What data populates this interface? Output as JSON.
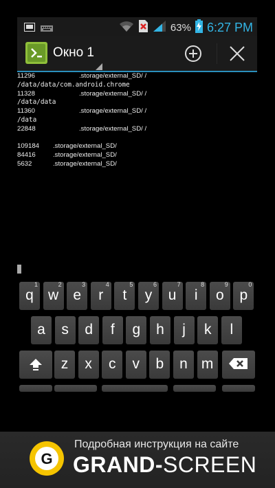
{
  "status_bar": {
    "battery_percent": "63%",
    "time": "6:27 PM",
    "icons": [
      "screen-icon",
      "keyboard-icon",
      "wifi-icon",
      "sim-icon",
      "signal-icon",
      "battery-charging-icon"
    ]
  },
  "action_bar": {
    "title": "Окно 1",
    "icons": [
      "app-icon",
      "add-window-icon",
      "close-window-icon"
    ]
  },
  "terminal": {
    "lines": [
      {
        "size": "11296",
        "path": ".storage/external_SD/ /",
        "style": "far"
      },
      {
        "text": "/data/data/com.android.chrome",
        "style": "mono"
      },
      {
        "size": "11328",
        "path": ".storage/external_SD/ /",
        "style": "far"
      },
      {
        "text": "/data/data",
        "style": "mono"
      },
      {
        "size": "11360",
        "path": ".storage/external_SD/ /",
        "style": "far"
      },
      {
        "text": "/data",
        "style": "mono"
      },
      {
        "size": "22848",
        "path": ".storage/external_SD/ /",
        "style": "far"
      },
      {
        "text": "",
        "style": "blank"
      },
      {
        "size": "109184",
        "path": ".storage/external_SD/",
        "style": "near"
      },
      {
        "size": "84416",
        "path": ".storage/external_SD/",
        "style": "near"
      },
      {
        "size": "5632",
        "path": ".storage/external_SD/",
        "style": "near"
      }
    ]
  },
  "keyboard": {
    "row1": [
      {
        "k": "q",
        "h": "1"
      },
      {
        "k": "w",
        "h": "2"
      },
      {
        "k": "e",
        "h": "3"
      },
      {
        "k": "r",
        "h": "4"
      },
      {
        "k": "t",
        "h": "5"
      },
      {
        "k": "y",
        "h": "6"
      },
      {
        "k": "u",
        "h": "7"
      },
      {
        "k": "i",
        "h": "8"
      },
      {
        "k": "o",
        "h": "9"
      },
      {
        "k": "p",
        "h": "0"
      }
    ],
    "row2": [
      "a",
      "s",
      "d",
      "f",
      "g",
      "h",
      "j",
      "k",
      "l"
    ],
    "row3": [
      "z",
      "x",
      "c",
      "v",
      "b",
      "n",
      "m"
    ]
  },
  "banner": {
    "line1": "Подробная инструкция на сайте",
    "brand_bold": "GRAND-",
    "brand_regular": "SCREEN",
    "logo_letter": "G"
  },
  "colors": {
    "accent": "#33b5e5",
    "actionbar_border": "#2a8fbd",
    "logo_yellow": "#f5c400"
  }
}
